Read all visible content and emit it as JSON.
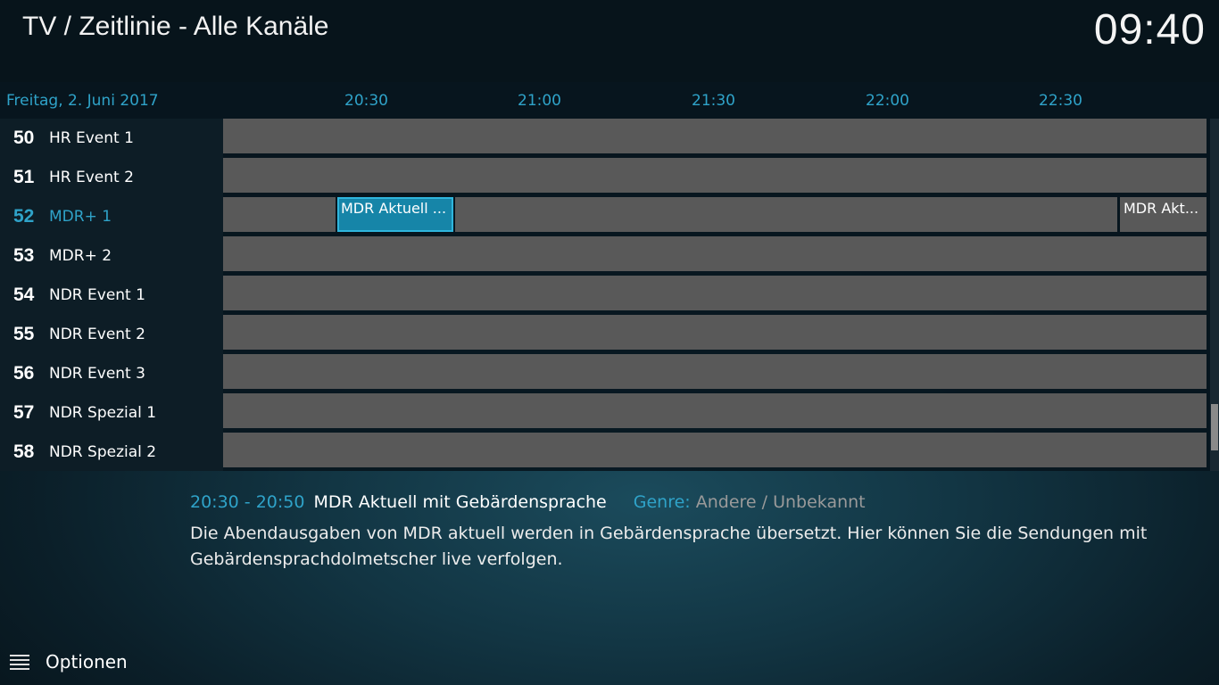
{
  "header": {
    "title": "TV / Zeitlinie - Alle Kanäle",
    "clock": "09:40"
  },
  "timeline": {
    "date": "Freitag, 2. Juni 2017",
    "time_labels": [
      "20:30",
      "21:00",
      "21:30",
      "22:00",
      "22:30"
    ]
  },
  "channels": [
    {
      "number": "50",
      "name": "HR Event 1",
      "selected": false
    },
    {
      "number": "51",
      "name": "HR Event 2",
      "selected": false
    },
    {
      "number": "52",
      "name": "MDR+ 1",
      "selected": true
    },
    {
      "number": "53",
      "name": "MDR+ 2",
      "selected": false
    },
    {
      "number": "54",
      "name": "NDR Event 1",
      "selected": false
    },
    {
      "number": "55",
      "name": "NDR Event 2",
      "selected": false
    },
    {
      "number": "56",
      "name": "NDR Event 3",
      "selected": false
    },
    {
      "number": "57",
      "name": "NDR Spezial 1",
      "selected": false
    },
    {
      "number": "58",
      "name": "NDR Spezial 2",
      "selected": false
    }
  ],
  "programs_row_52": [
    {
      "title": "",
      "focused": false
    },
    {
      "title": "MDR Aktuell ...",
      "focused": true
    },
    {
      "title": "",
      "focused": false
    },
    {
      "title": "MDR Akt...",
      "focused": false
    }
  ],
  "info": {
    "time": "20:30 - 20:50",
    "title": "MDR Aktuell mit Gebärdensprache",
    "genre_label": "Genre:",
    "genre": "Andere / Unbekannt",
    "description": "Die Abendausgaben von MDR aktuell werden in Gebärdensprache übersetzt. Hier können Sie die Sendungen mit Gebärdensprachdolmetscher live verfolgen."
  },
  "footer": {
    "options_label": "Optionen",
    "icon": "menu-icon"
  },
  "colors": {
    "accent": "#2fa3c9",
    "program_block": "#595959",
    "focused_block": "#1685a8"
  }
}
